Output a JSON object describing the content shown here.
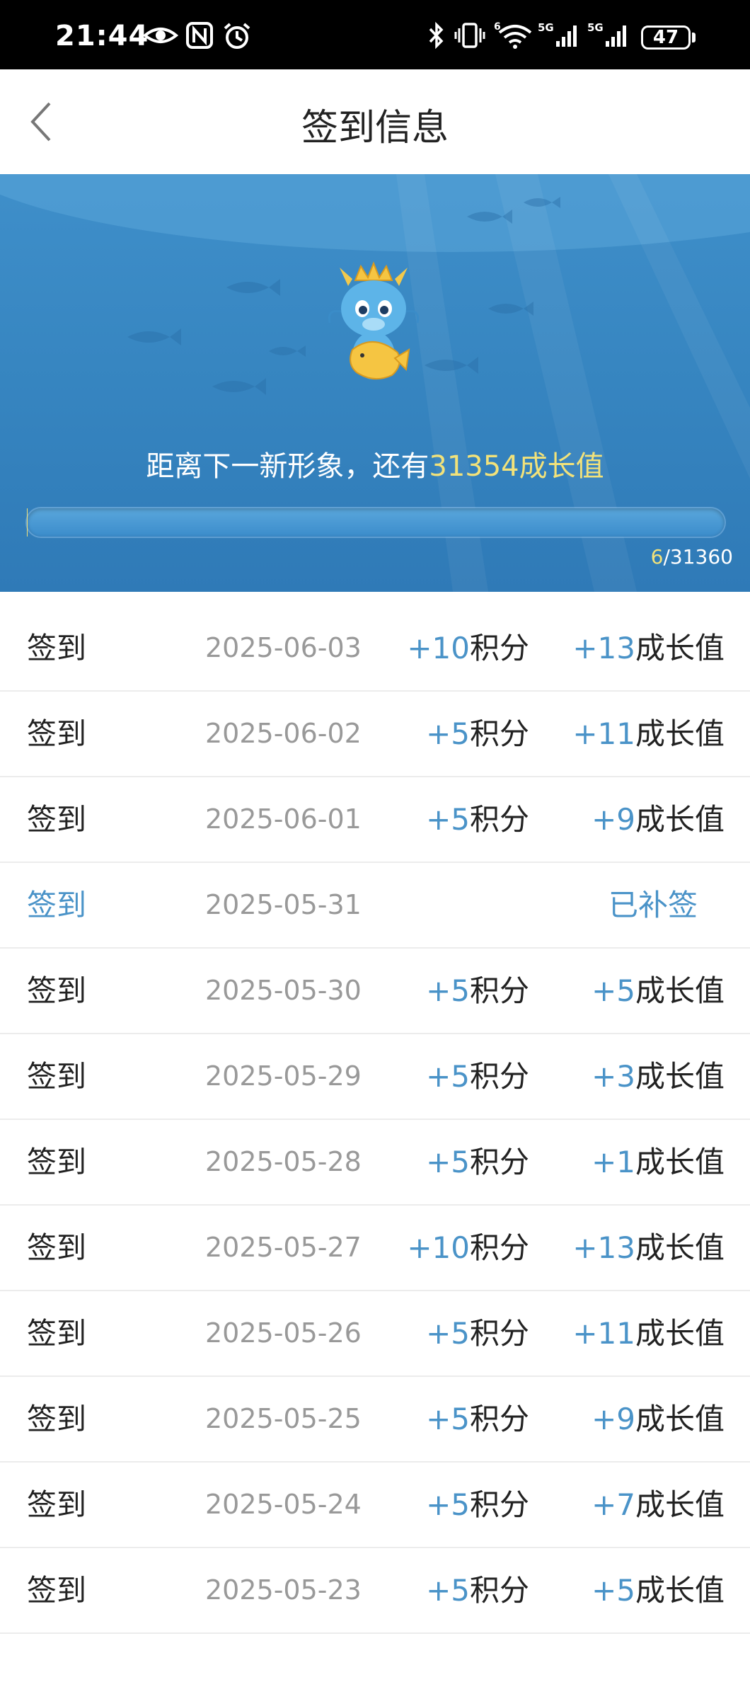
{
  "status_bar": {
    "time": "21:44",
    "battery": "47"
  },
  "header": {
    "title": "签到信息"
  },
  "banner": {
    "text_prefix": "距离下一新形象，还有",
    "remaining": "31354成长值",
    "progress_current": "6",
    "progress_separator": "/",
    "progress_total": "31360",
    "progress_fraction": 0.0002
  },
  "records": [
    {
      "label": "签到",
      "date": "2025-06-03",
      "points": "+10",
      "points_unit": "积分",
      "growth": "+13",
      "growth_unit": "成长值"
    },
    {
      "label": "签到",
      "date": "2025-06-02",
      "points": "+5",
      "points_unit": "积分",
      "growth": "+11",
      "growth_unit": "成长值"
    },
    {
      "label": "签到",
      "date": "2025-06-01",
      "points": "+5",
      "points_unit": "积分",
      "growth": "+9",
      "growth_unit": "成长值"
    },
    {
      "label": "签到",
      "date": "2025-05-31",
      "status": "已补签"
    },
    {
      "label": "签到",
      "date": "2025-05-30",
      "points": "+5",
      "points_unit": "积分",
      "growth": "+5",
      "growth_unit": "成长值"
    },
    {
      "label": "签到",
      "date": "2025-05-29",
      "points": "+5",
      "points_unit": "积分",
      "growth": "+3",
      "growth_unit": "成长值"
    },
    {
      "label": "签到",
      "date": "2025-05-28",
      "points": "+5",
      "points_unit": "积分",
      "growth": "+1",
      "growth_unit": "成长值"
    },
    {
      "label": "签到",
      "date": "2025-05-27",
      "points": "+10",
      "points_unit": "积分",
      "growth": "+13",
      "growth_unit": "成长值"
    },
    {
      "label": "签到",
      "date": "2025-05-26",
      "points": "+5",
      "points_unit": "积分",
      "growth": "+11",
      "growth_unit": "成长值"
    },
    {
      "label": "签到",
      "date": "2025-05-25",
      "points": "+5",
      "points_unit": "积分",
      "growth": "+9",
      "growth_unit": "成长值"
    },
    {
      "label": "签到",
      "date": "2025-05-24",
      "points": "+5",
      "points_unit": "积分",
      "growth": "+7",
      "growth_unit": "成长值"
    },
    {
      "label": "签到",
      "date": "2025-05-23",
      "points": "+5",
      "points_unit": "积分",
      "growth": "+5",
      "growth_unit": "成长值"
    }
  ]
}
